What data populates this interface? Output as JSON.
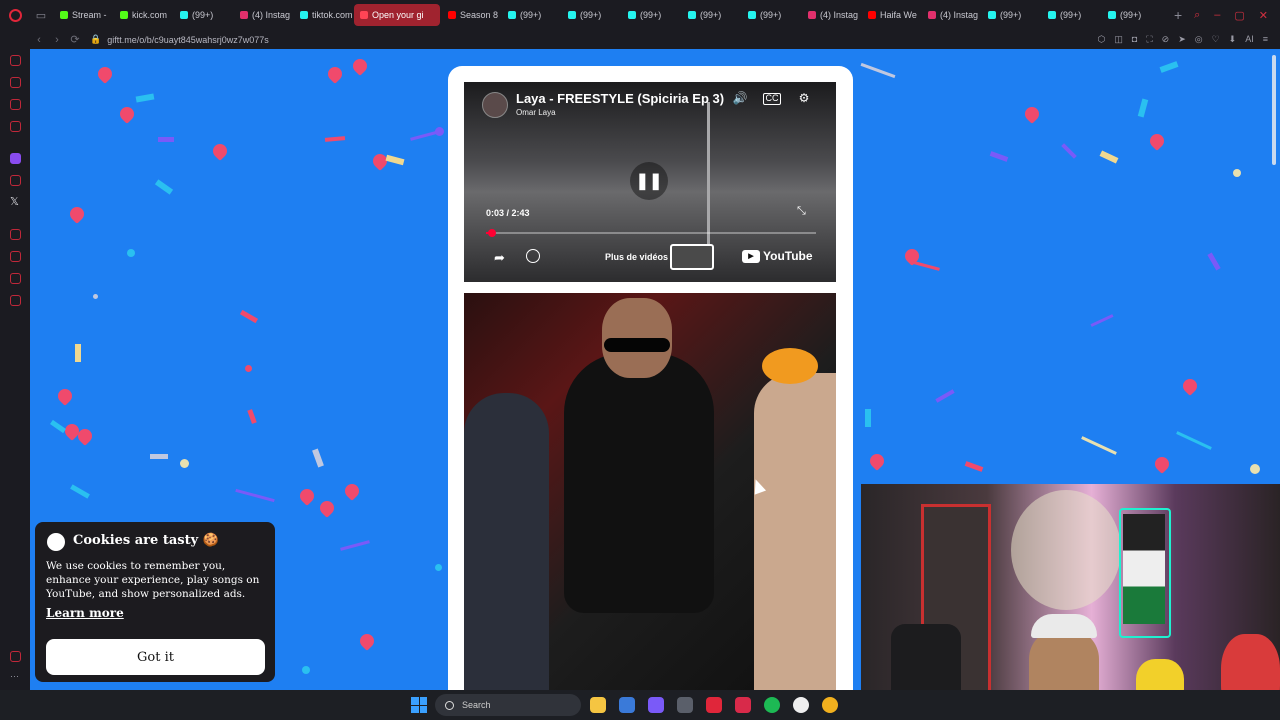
{
  "browser": {
    "workspace_icon": "▭",
    "tabs": [
      {
        "label": "Stream - ",
        "favicon_color": "#53fc18",
        "active": false
      },
      {
        "label": "kick.com",
        "favicon_color": "#53fc18",
        "active": false
      },
      {
        "label": "(99+)",
        "favicon_color": "#25f4ee",
        "active": false
      },
      {
        "label": "(4) Instag",
        "favicon_color": "#e1306c",
        "active": false
      },
      {
        "label": "tiktok.com",
        "favicon_color": "#25f4ee",
        "active": false
      },
      {
        "label": "Open your gi",
        "favicon_color": "#ff4455",
        "active": true
      },
      {
        "label": "Season 8",
        "favicon_color": "#ff0000",
        "active": false
      },
      {
        "label": "(99+)",
        "favicon_color": "#25f4ee",
        "active": false
      },
      {
        "label": "(99+)",
        "favicon_color": "#25f4ee",
        "active": false
      },
      {
        "label": "(99+)",
        "favicon_color": "#25f4ee",
        "active": false
      },
      {
        "label": "(99+)",
        "favicon_color": "#25f4ee",
        "active": false
      },
      {
        "label": "(99+)",
        "favicon_color": "#25f4ee",
        "active": false
      },
      {
        "label": "(4) Instag",
        "favicon_color": "#e1306c",
        "active": false
      },
      {
        "label": "Haifa We",
        "favicon_color": "#ff0000",
        "active": false
      },
      {
        "label": "(4) Instag",
        "favicon_color": "#e1306c",
        "active": false
      },
      {
        "label": "(99+)",
        "favicon_color": "#25f4ee",
        "active": false
      },
      {
        "label": "(99+)",
        "favicon_color": "#25f4ee",
        "active": false
      },
      {
        "label": "(99+)",
        "favicon_color": "#25f4ee",
        "active": false
      }
    ],
    "new_tab_icon": "+",
    "window_controls": [
      "⌕",
      "–",
      "▢",
      "✕"
    ],
    "url": "giftt.me/o/b/c9uayt845wahsrj0wz7w077s",
    "nav": [
      "‹",
      "›",
      "⟳"
    ],
    "lock_icon": "🔒",
    "address_icons": [
      "⬡",
      "◫",
      "◘",
      "⛶",
      "⊘",
      "➤",
      "◎",
      "♡",
      "⬇",
      "AI",
      "≡"
    ],
    "sidebar_x_label": "𝕏",
    "sidebar_more_label": "···",
    "accent_color": "#c0283a"
  },
  "video": {
    "title": "Laya - FREESTYLE (Spiciria Ep 3)",
    "channel": "Omar Laya",
    "current_time": "0:03",
    "duration": "2:43",
    "time_display": "0:03 / 2:43",
    "progress_fraction": 0.018,
    "pause_icon": "❚❚",
    "volume_icon": "🔊",
    "cc_icon": "CC",
    "settings_icon": "⚙",
    "share_icon": "➦",
    "expand_icon": "⤡",
    "more_videos_label": "Plus de vidéos",
    "youtube_label": "YouTube",
    "youtube_logo_icon": "▶"
  },
  "cookie": {
    "title": "Cookies are tasty 🍪",
    "body": "We use cookies to remember you, enhance your experience, play songs on YouTube, and show personalized ads.",
    "learn_more": "Learn more",
    "button": "Got it"
  },
  "taskbar": {
    "search_label": "Search",
    "apps": [
      {
        "name": "file-explorer",
        "color": "#f5c542"
      },
      {
        "name": "store",
        "color": "#3a7ad9"
      },
      {
        "name": "copilot",
        "color": "#7a5af8"
      },
      {
        "name": "calculator",
        "color": "#5a5f6a"
      },
      {
        "name": "opera",
        "color": "#e0263a"
      },
      {
        "name": "opera-gx",
        "color": "#d82a4a"
      },
      {
        "name": "spotify",
        "color": "#1db954"
      },
      {
        "name": "discord",
        "color": "#eee"
      },
      {
        "name": "chrome",
        "color": "#f2b01e"
      }
    ]
  },
  "page": {
    "background_color": "#1e7ff2"
  }
}
